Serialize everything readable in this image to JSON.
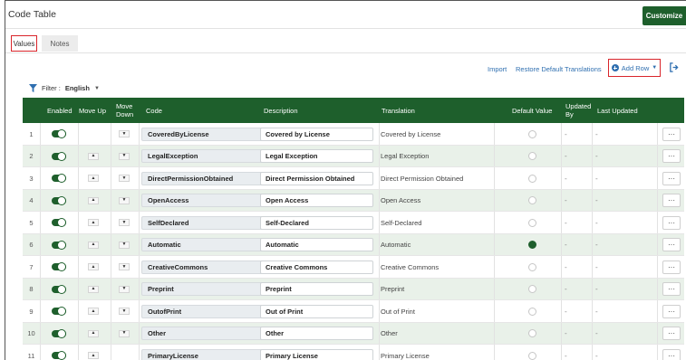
{
  "page": {
    "title": "Code Table",
    "customize_label": "Customize"
  },
  "tabs": [
    {
      "label": "Values",
      "active": true
    },
    {
      "label": "Notes",
      "active": false
    }
  ],
  "toolbar": {
    "import_label": "Import",
    "restore_label": "Restore Default Translations",
    "add_row_label": "Add Row"
  },
  "filter": {
    "prefix": "Filter :",
    "value": "English"
  },
  "table": {
    "headers": {
      "enabled": "Enabled",
      "move_up": "Move Up",
      "move_down": "Move Down",
      "code": "Code",
      "description": "Description",
      "translation": "Translation",
      "default_value": "Default Value",
      "updated_by": "Updated By",
      "last_updated": "Last Updated"
    },
    "rows": [
      {
        "index": "1",
        "code": "CoveredByLicense",
        "description": "Covered by License",
        "translation": "Covered by License",
        "default": false,
        "updated_by": "-",
        "last_updated": "-",
        "move_up": false,
        "move_down": true
      },
      {
        "index": "2",
        "code": "LegalException",
        "description": "Legal Exception",
        "translation": "Legal Exception",
        "default": false,
        "updated_by": "-",
        "last_updated": "-",
        "move_up": true,
        "move_down": true
      },
      {
        "index": "3",
        "code": "DirectPermissionObtained",
        "description": "Direct Permission Obtained",
        "translation": "Direct Permission Obtained",
        "default": false,
        "updated_by": "-",
        "last_updated": "-",
        "move_up": true,
        "move_down": true
      },
      {
        "index": "4",
        "code": "OpenAccess",
        "description": "Open Access",
        "translation": "Open Access",
        "default": false,
        "updated_by": "-",
        "last_updated": "-",
        "move_up": true,
        "move_down": true
      },
      {
        "index": "5",
        "code": "SelfDeclared",
        "description": "Self-Declared",
        "translation": "Self-Declared",
        "default": false,
        "updated_by": "-",
        "last_updated": "-",
        "move_up": true,
        "move_down": true
      },
      {
        "index": "6",
        "code": "Automatic",
        "description": "Automatic",
        "translation": "Automatic",
        "default": true,
        "updated_by": "-",
        "last_updated": "-",
        "move_up": true,
        "move_down": true
      },
      {
        "index": "7",
        "code": "CreativeCommons",
        "description": "Creative Commons",
        "translation": "Creative Commons",
        "default": false,
        "updated_by": "-",
        "last_updated": "-",
        "move_up": true,
        "move_down": true
      },
      {
        "index": "8",
        "code": "Preprint",
        "description": "Preprint",
        "translation": "Preprint",
        "default": false,
        "updated_by": "-",
        "last_updated": "-",
        "move_up": true,
        "move_down": true
      },
      {
        "index": "9",
        "code": "OutofPrint",
        "description": "Out of Print",
        "translation": "Out of Print",
        "default": false,
        "updated_by": "-",
        "last_updated": "-",
        "move_up": true,
        "move_down": true
      },
      {
        "index": "10",
        "code": "Other",
        "description": "Other",
        "translation": "Other",
        "default": false,
        "updated_by": "-",
        "last_updated": "-",
        "move_up": true,
        "move_down": true
      },
      {
        "index": "11",
        "code": "PrimaryLicense",
        "description": "Primary License",
        "translation": "Primary License",
        "default": false,
        "updated_by": "-",
        "last_updated": "-",
        "move_up": true,
        "move_down": false
      }
    ]
  },
  "icons": {
    "filter": "funnel-icon",
    "add": "plus-circle-icon",
    "export": "export-icon",
    "more": "ellipsis-icon",
    "toggle": "toggle-on-icon"
  },
  "colors": {
    "accent": "#1e5f2c",
    "link": "#2f6fb0",
    "highlight": "#d9252b",
    "row_alt": "#e9f1e9"
  }
}
